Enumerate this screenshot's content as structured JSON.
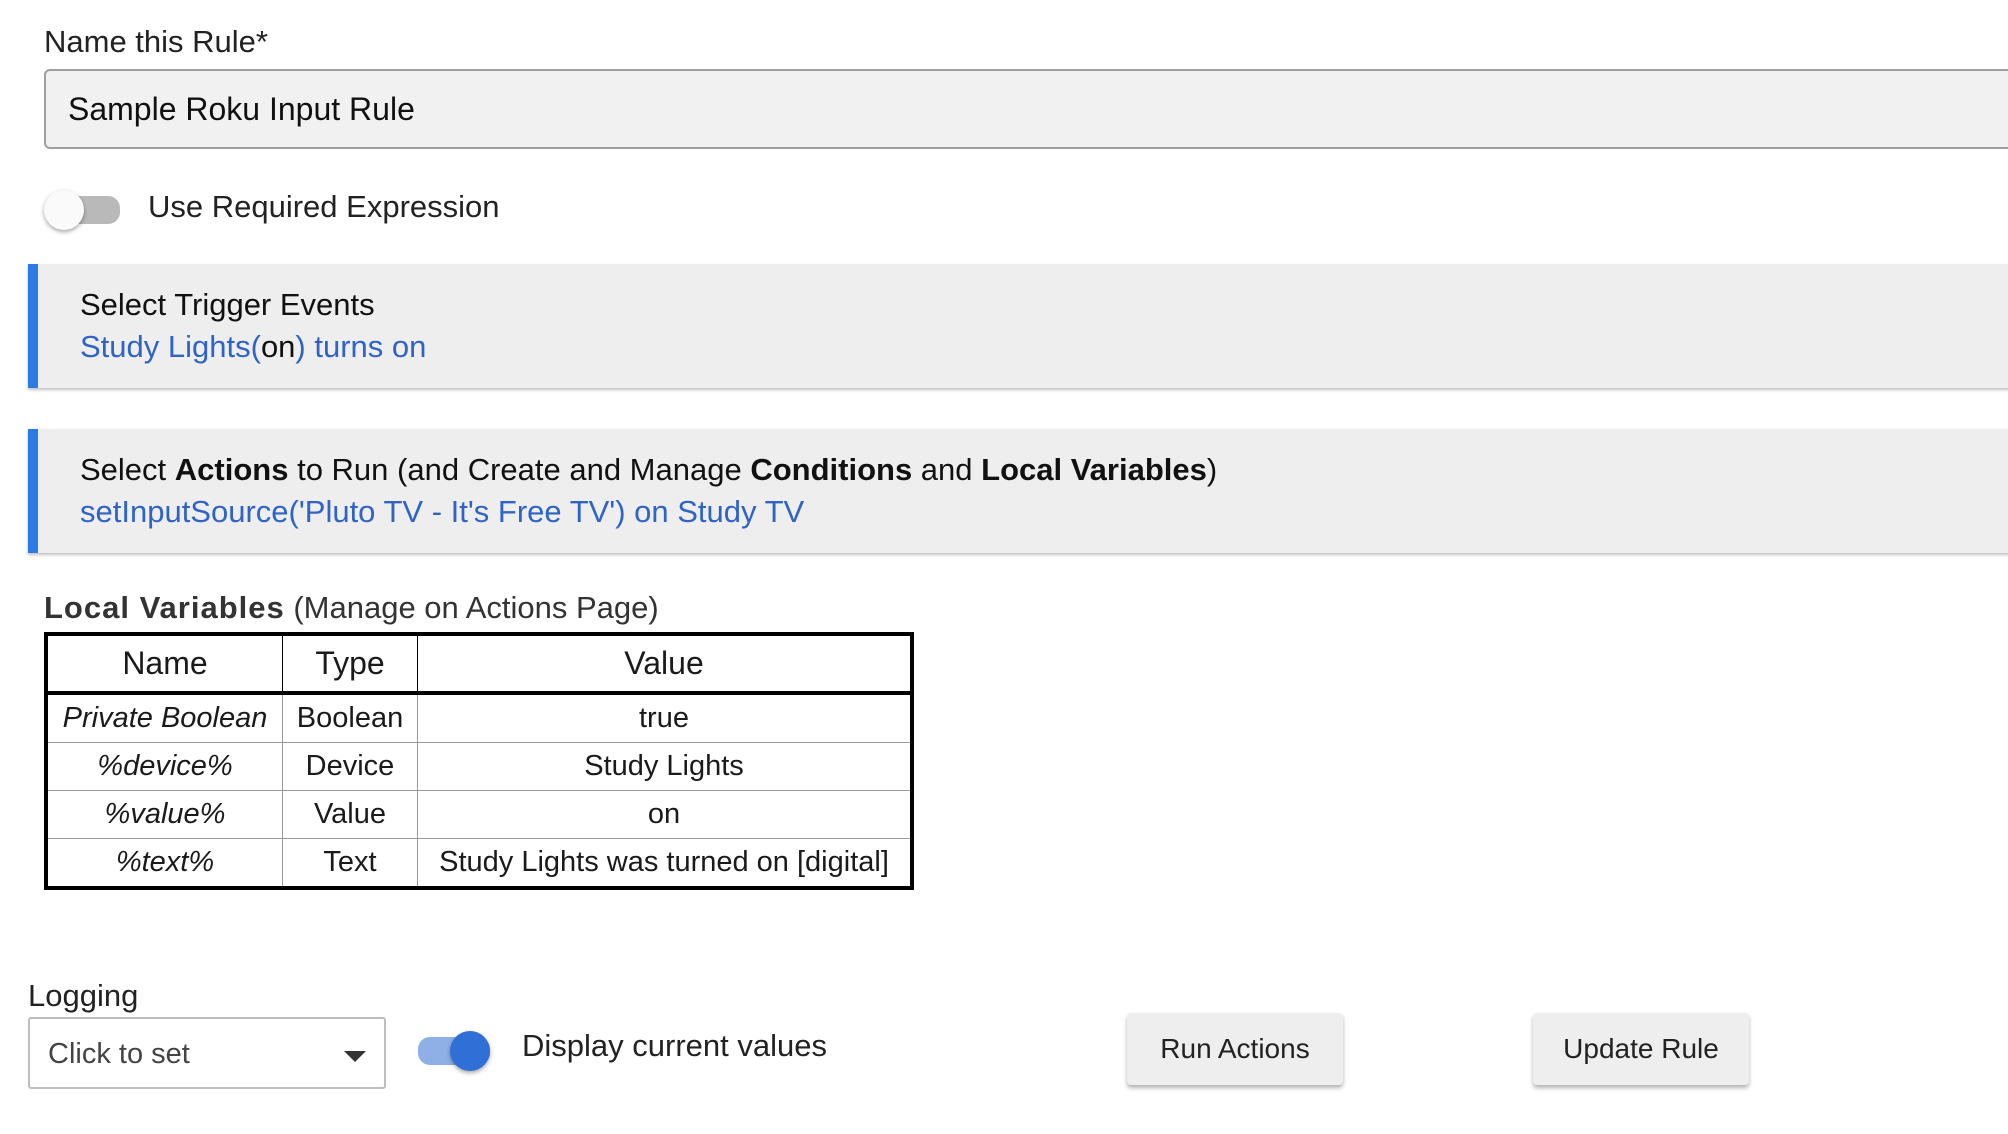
{
  "rule_name": {
    "label": "Name this Rule*",
    "value": "Sample Roku Input Rule"
  },
  "required_expression": {
    "label": "Use Required Expression",
    "enabled": false
  },
  "trigger_section": {
    "title": "Select Trigger Events",
    "device": "Study Lights",
    "state_open": "(",
    "state": "on",
    "state_close": ")",
    "event": "turns on"
  },
  "actions_section": {
    "title_parts": {
      "p1": "Select ",
      "b1": "Actions",
      "p2": " to Run (and Create and Manage ",
      "b2": "Conditions",
      "p3": " and ",
      "b3": "Local Variables",
      "p4": ")"
    },
    "action": "setInputSource('Pluto TV - It's Free TV') on Study TV"
  },
  "local_variables": {
    "heading_bold": "Local Variables",
    "heading_rest": " (Manage on Actions Page)",
    "columns": [
      "Name",
      "Type",
      "Value"
    ],
    "rows": [
      {
        "name": "Private Boolean",
        "type": "Boolean",
        "value": "true"
      },
      {
        "name": "%device%",
        "type": "Device",
        "value": "Study Lights"
      },
      {
        "name": "%value%",
        "type": "Value",
        "value": "on"
      },
      {
        "name": "%text%",
        "type": "Text",
        "value": "Study Lights was turned on [digital]"
      }
    ]
  },
  "logging": {
    "label": "Logging",
    "selected": "Click to set"
  },
  "display_values": {
    "label": "Display current values",
    "enabled": true
  },
  "buttons": {
    "run": "Run Actions",
    "update": "Update Rule"
  },
  "colors": {
    "accent": "#2c7be5",
    "link": "#2f63c4",
    "panel": "#eeeeee"
  }
}
